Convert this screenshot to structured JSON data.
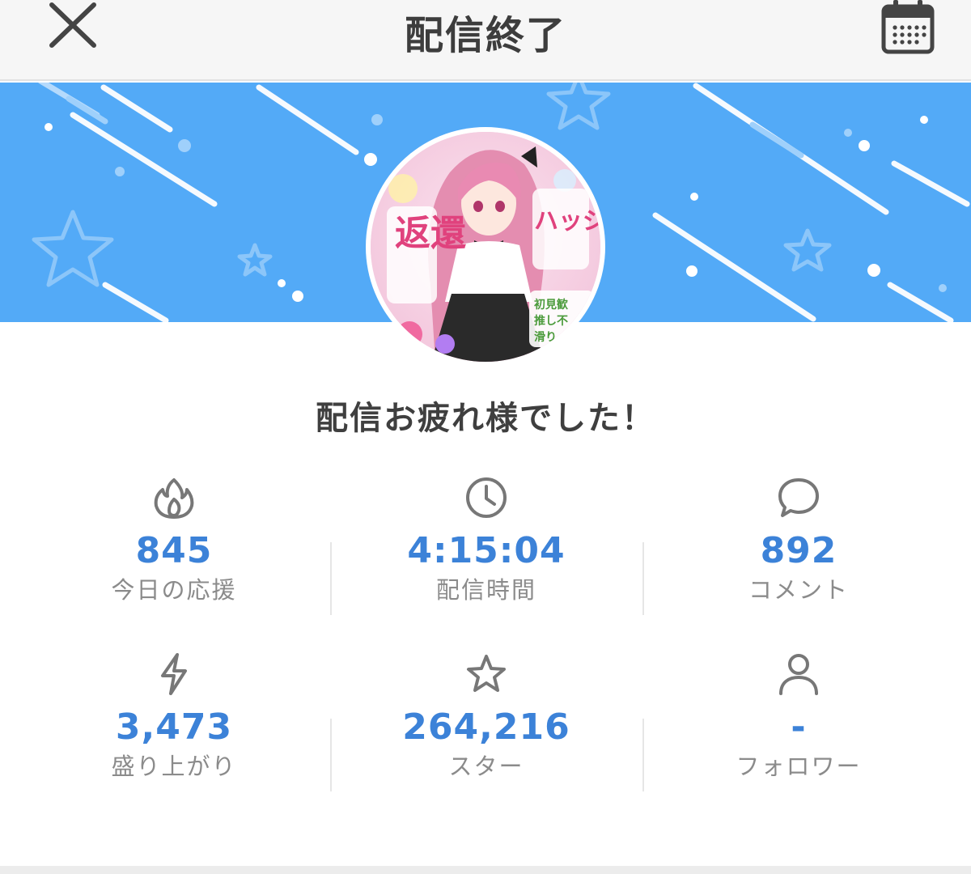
{
  "header": {
    "title": "配信終了",
    "close_icon": "close-icon",
    "calendar_icon": "calendar-icon"
  },
  "banner": {
    "background_color": "#53aaf7"
  },
  "avatar": {
    "texts": [
      "返還",
      "ハッジ",
      "初見歓",
      "推し不",
      "滑り"
    ]
  },
  "greeting": "配信お疲れ様でした！",
  "stats": [
    {
      "icon": "flame-icon",
      "value": "845",
      "label": "今日の応援"
    },
    {
      "icon": "clock-icon",
      "value": "4:15:04",
      "label": "配信時間"
    },
    {
      "icon": "speech-bubble-icon",
      "value": "892",
      "label": "コメント"
    },
    {
      "icon": "lightning-icon",
      "value": "3,473",
      "label": "盛り上がり"
    },
    {
      "icon": "star-icon",
      "value": "264,216",
      "label": "スター"
    },
    {
      "icon": "person-icon",
      "value": "-",
      "label": "フォロワー"
    }
  ],
  "colors": {
    "accent": "#3c82d8",
    "label_gray": "#8b8b8b",
    "banner": "#53aaf7"
  }
}
